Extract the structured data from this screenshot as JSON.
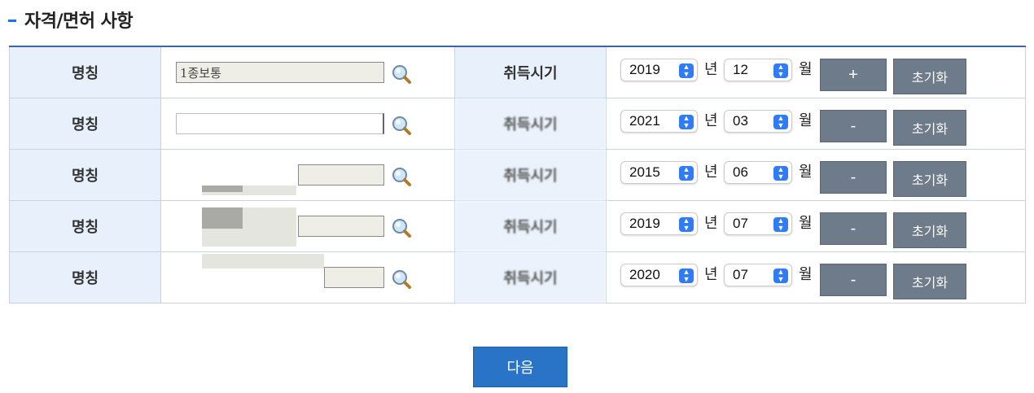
{
  "section": {
    "title": "자격/면허 사항"
  },
  "rows": [
    {
      "name_label": "명칭",
      "name_value": "1종보통",
      "date_label": "취득시기",
      "year": "2019",
      "year_unit": "년",
      "month": "12",
      "month_unit": "월",
      "action": "+",
      "reset": "초기화"
    },
    {
      "name_label": "명칭",
      "name_value": "",
      "date_label": "취득시기",
      "year": "2021",
      "year_unit": "년",
      "month": "03",
      "month_unit": "월",
      "action": "-",
      "reset": "초기화"
    },
    {
      "name_label": "명칭",
      "name_value": "",
      "date_label": "취득시기",
      "year": "2015",
      "year_unit": "년",
      "month": "06",
      "month_unit": "월",
      "action": "-",
      "reset": "초기화"
    },
    {
      "name_label": "명칭",
      "name_value": "",
      "date_label": "취득시기",
      "year": "2019",
      "year_unit": "년",
      "month": "07",
      "month_unit": "월",
      "action": "-",
      "reset": "초기화"
    },
    {
      "name_label": "명칭",
      "name_value": "",
      "date_label": "취득시기",
      "year": "2020",
      "year_unit": "년",
      "month": "07",
      "month_unit": "월",
      "action": "-",
      "reset": "초기화"
    }
  ],
  "footer": {
    "next_label": "다음"
  },
  "colors": {
    "accent": "#1a73e8",
    "header_border": "#3a63a8",
    "label_bg": "#e8f0fb",
    "button_gray": "#6e7b8a",
    "next_blue": "#2a74c8"
  }
}
